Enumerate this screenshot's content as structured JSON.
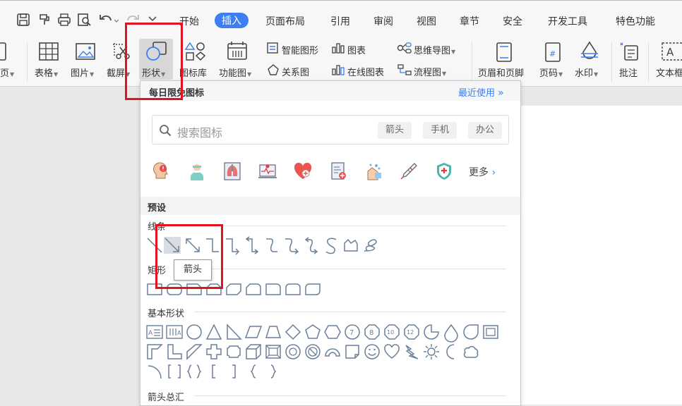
{
  "menu": {
    "tabs": [
      "开始",
      "插入",
      "页面布局",
      "引用",
      "审阅",
      "视图",
      "章节",
      "安全",
      "开发工具",
      "特色功能"
    ],
    "active_tab": "插入",
    "accent_color": "#3d7ff0"
  },
  "ribbon": {
    "page_label": "页",
    "table_label": "表格",
    "picture_label": "图片",
    "screenshot_label": "截屏",
    "shape_label": "形状",
    "iconlib_label": "图标库",
    "function_label": "功能图",
    "smart_shape_label": "智能图形",
    "chart_label": "图表",
    "mindmap_label": "思维导图",
    "relation_label": "关系图",
    "online_chart_label": "在线图表",
    "flowchart_label": "流程图",
    "header_footer_label": "页眉和页脚",
    "page_number_label": "页码",
    "watermark_label": "水印",
    "comment_label": "批注",
    "textbox_label": "文本框"
  },
  "panel": {
    "title": "每日限免图标",
    "recent_label": "最近使用",
    "recent_chevron": "»",
    "search_placeholder": "搜索图标",
    "chips": [
      "箭头",
      "手机",
      "办公"
    ],
    "more_label": "更多",
    "preset_label": "预设",
    "sections": {
      "lines": "线条",
      "rect": "矩形",
      "basic": "基本形状",
      "arrows": "箭头总汇"
    },
    "tooltip": "箭头",
    "highlight_color": "#e0141e"
  }
}
